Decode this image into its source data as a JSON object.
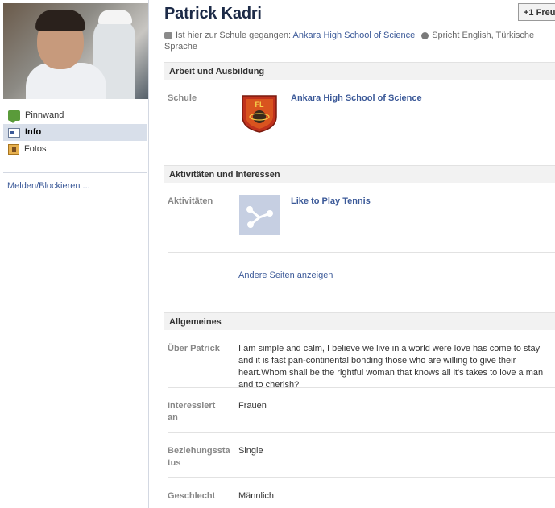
{
  "profile": {
    "name": "Patrick Kadri",
    "friend_button": "+1 Freu",
    "school_prefix": "Ist hier zur Schule gegangen:",
    "school_link": "Ankara High School of Science",
    "languages_text": "Spricht English, Türkische Sprache"
  },
  "nav": {
    "items": [
      {
        "label": "Pinnwand",
        "icon": "wall-icon"
      },
      {
        "label": "Info",
        "icon": "info-icon"
      },
      {
        "label": "Fotos",
        "icon": "photos-icon"
      }
    ],
    "report": "Melden/Blockieren ..."
  },
  "sections": {
    "work": {
      "title": "Arbeit und Ausbildung",
      "school_label": "Schule",
      "school_name": "Ankara High School of Science",
      "logo_text": "FL"
    },
    "activities": {
      "title": "Aktivitäten und Interessen",
      "activities_label": "Aktivitäten",
      "activity_name": "Like to Play Tennis",
      "more_pages": "Andere Seiten anzeigen"
    },
    "general": {
      "title": "Allgemeines",
      "about_label": "Über Patrick",
      "about_text": "I am simple and calm, I believe we live in a world were love has come to stay and it is fast pan-continental bonding those who are willing to give their heart.Whom shall be the rightful woman that knows all it's takes to love a man and to cherish?",
      "interested_label": "Interessiert an",
      "interested_value": "Frauen",
      "relationship_label": "Beziehungsstatus",
      "relationship_value": "Single",
      "gender_label": "Geschlecht",
      "gender_value": "Männlich"
    }
  },
  "colors": {
    "link": "#3b5998",
    "name": "#1c2a47",
    "active_nav": "#d8dfea"
  }
}
